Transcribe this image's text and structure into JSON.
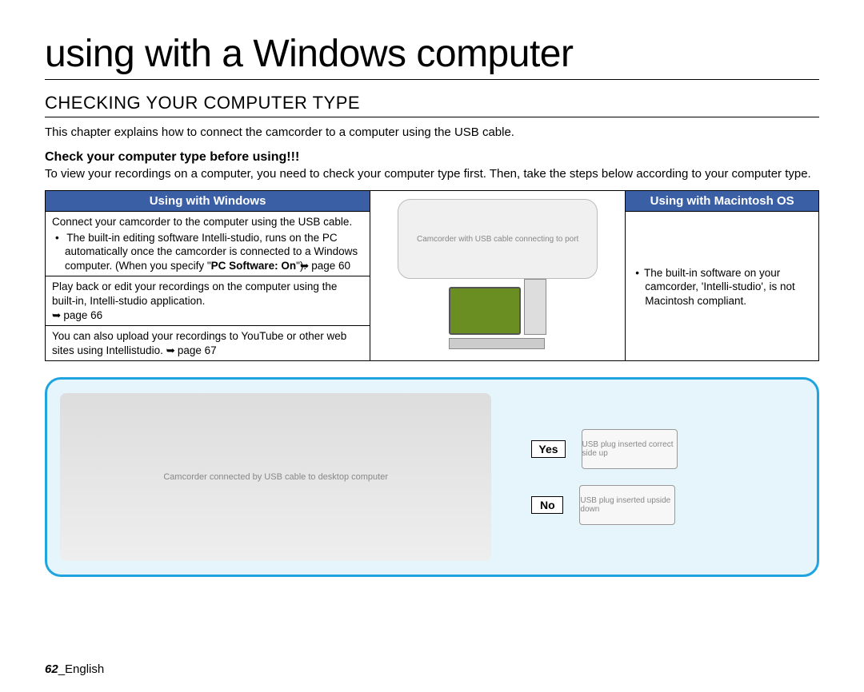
{
  "page": {
    "title": "using with a Windows computer",
    "section_title": "CHECKING YOUR COMPUTER TYPE",
    "intro": "This chapter explains how to connect the camcorder to a computer using the USB cable.",
    "sub_heading": "Check your computer type before using!!!",
    "sub_intro": "To view your recordings on a computer, you need to check your computer type first. Then, take the steps below according to your computer type."
  },
  "table": {
    "headers": {
      "windows": "Using with Windows",
      "mac": "Using with Macintosh OS"
    },
    "windows_cells": [
      {
        "lead": "Connect your camcorder to the computer using the USB cable.",
        "bullets": [
          "The built-in editing software Intelli-studio, runs on the PC automatically once the camcorder is connected to a Windows computer. (When you specify \"PC Software: On\"). ➥ page 60"
        ],
        "bold_fragment": "PC Software: On",
        "page_ref": "page 60"
      },
      {
        "lead": "Play back or edit your recordings on the computer using the built-in, Intelli-studio application.",
        "page_ref": "page 66"
      },
      {
        "lead": "You can also upload your recordings to YouTube or other web sites using Intellistudio. ➥ page 67",
        "page_ref": "page 67"
      }
    ],
    "mac_cell": {
      "bullets": [
        "The built-in software on your camcorder, 'Intelli-studio', is not Macintosh compliant."
      ]
    },
    "middle_images": {
      "top_alt": "Camcorder with USB cable connecting to port",
      "bottom_alt": "Windows desktop computer"
    }
  },
  "diagram": {
    "main_alt": "Camcorder connected by USB cable to desktop computer",
    "yes_label": "Yes",
    "no_label": "No",
    "usb_yes_alt": "USB plug inserted correct side up",
    "usb_no_alt": "USB plug inserted upside down"
  },
  "footer": {
    "page_number": "62",
    "separator": "_",
    "language": "English"
  }
}
